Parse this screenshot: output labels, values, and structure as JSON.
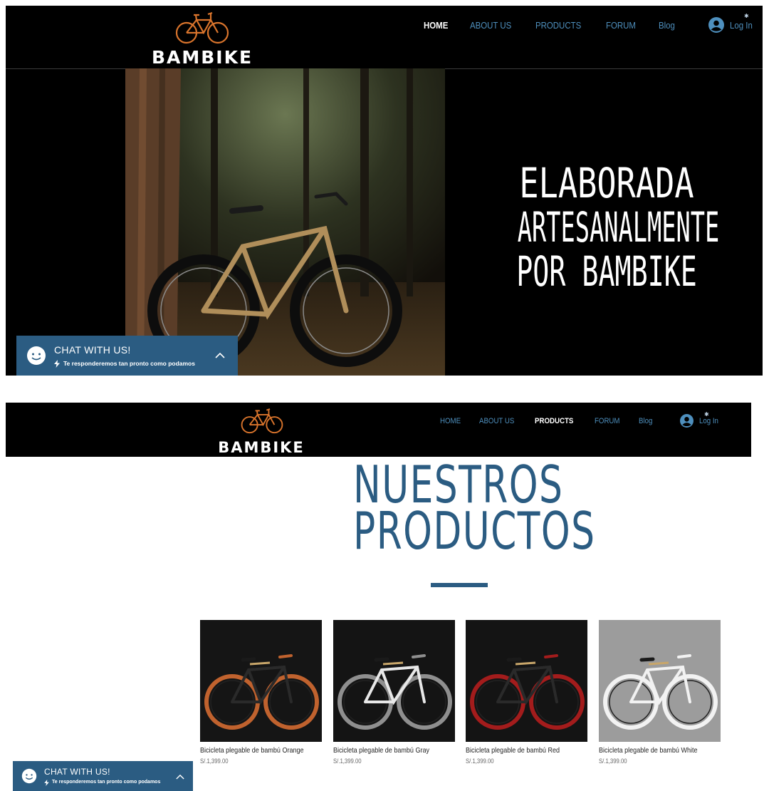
{
  "site": {
    "brand": "BAMBIKE",
    "nav": [
      {
        "label": "HOME"
      },
      {
        "label": "ABOUT US"
      },
      {
        "label": "PRODUCTS"
      },
      {
        "label": "FORUM"
      },
      {
        "label": "Blog"
      }
    ],
    "login_label": "Log In"
  },
  "screen1": {
    "active_nav": "HOME",
    "hero_lines": [
      "ELABORADA",
      "ARTESANALMENTE",
      "POR BAMBIKE"
    ]
  },
  "screen2": {
    "active_nav": "PRODUCTS",
    "title_lines": [
      "NUESTROS",
      "PRODUCTOS"
    ],
    "products": [
      {
        "name": "Bicicleta plegable de bambú Orange",
        "price": "S/.1,399.00",
        "accent": "#c0622e",
        "bg": "#151515",
        "frame": "#2a2a2a"
      },
      {
        "name": "Bicicleta plegable de bambú Gray",
        "price": "S/.1,399.00",
        "accent": "#8f8f8f",
        "bg": "#141414",
        "frame": "#e8e8e8"
      },
      {
        "name": "Bicicleta plegable de bambú Red",
        "price": "S/.1,399.00",
        "accent": "#a31c1c",
        "bg": "#141414",
        "frame": "#2a2a2a"
      },
      {
        "name": "Bicicleta plegable de bambú White",
        "price": "S/.1,399.00",
        "accent": "#f2f2f2",
        "bg": "#9c9c9c",
        "frame": "#f2f2f2"
      }
    ]
  },
  "chat": {
    "title": "CHAT WITH US!",
    "subtitle": "Te responderemos tan pronto como podamos"
  },
  "colors": {
    "brand_blue": "#2b5c82",
    "nav_blue": "#4e8fbd",
    "logo_orange": "#d9742c"
  }
}
